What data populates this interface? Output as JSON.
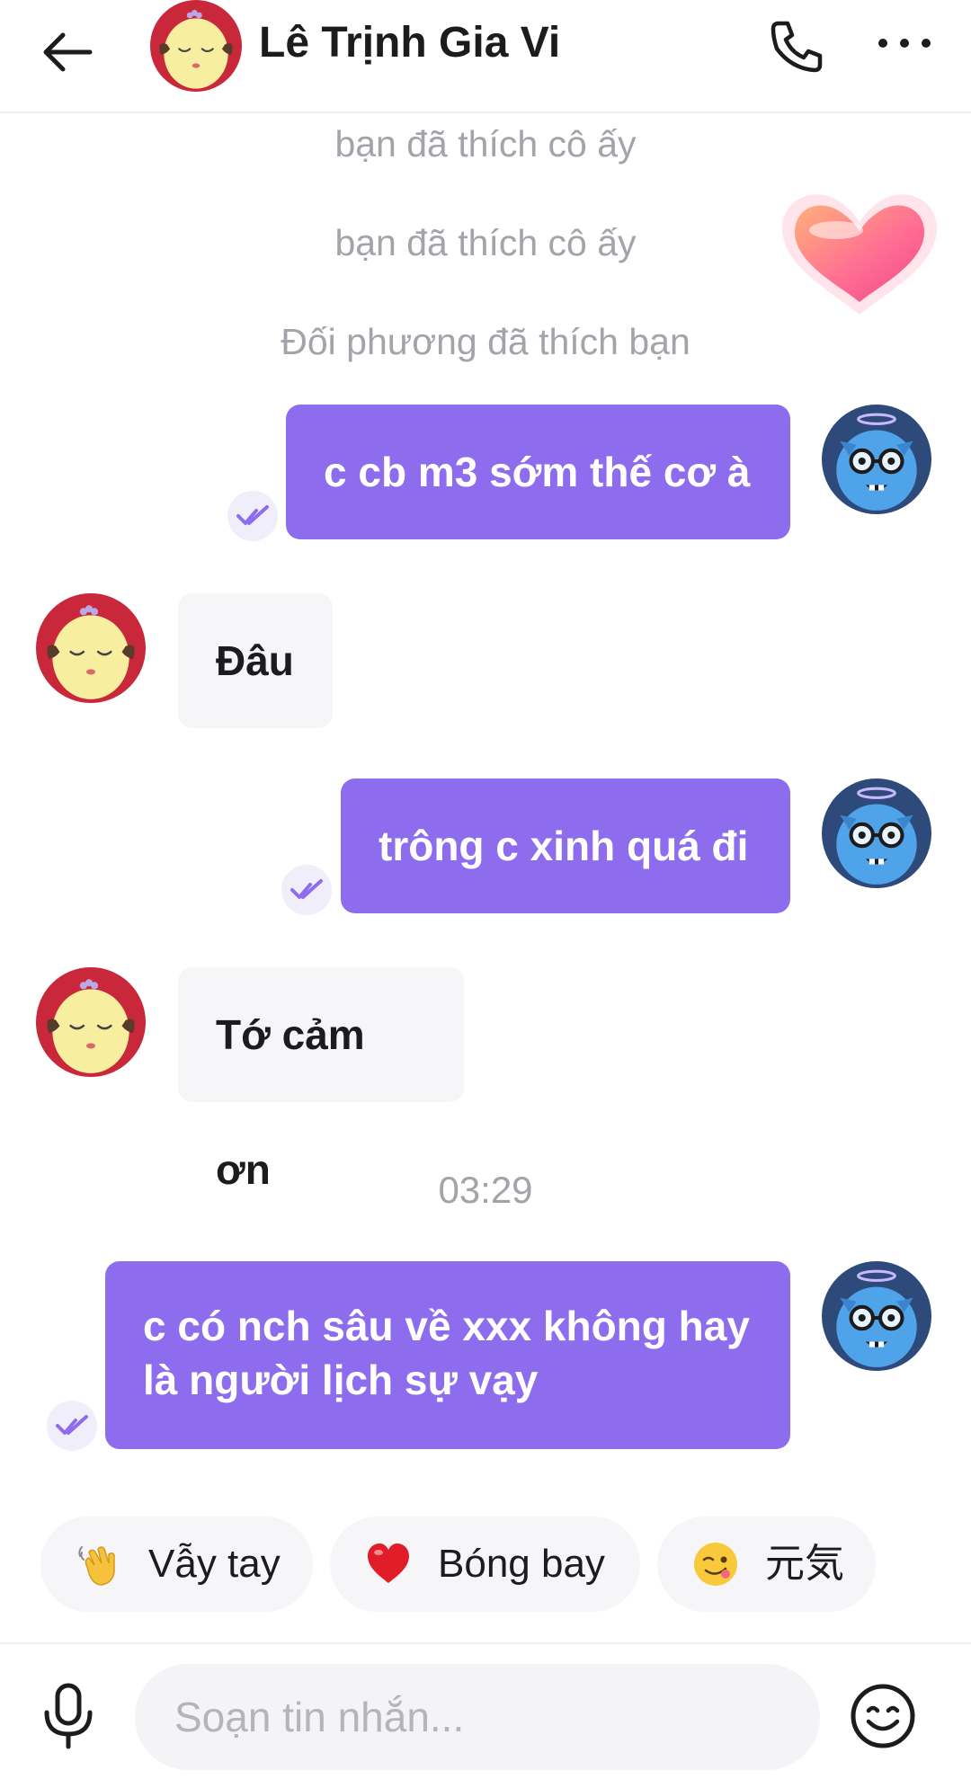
{
  "header": {
    "contact_name": "Lê Trịnh Gia Vi"
  },
  "system_messages": [
    "bạn đã thích cô ấy",
    "bạn đã thích cô ấy",
    "Đối phương đã thích bạn"
  ],
  "messages": [
    {
      "from": "me",
      "text": "c cb m3 sớm thế cơ à"
    },
    {
      "from": "them",
      "text": "Đâu"
    },
    {
      "from": "me",
      "text": "trông c xinh quá đi"
    },
    {
      "from": "them",
      "text": "Tớ cảm ơn"
    },
    {
      "from": "me",
      "text_line1": "c có nch sâu về xxx không hay",
      "text_line2": "là người lịch sự vạy"
    }
  ],
  "timestamp": "03:29",
  "quick_replies": [
    {
      "icon": "waving-hand-icon",
      "label": "Vẫy tay"
    },
    {
      "icon": "red-heart-icon",
      "label": "Bóng bay"
    },
    {
      "icon": "winking-face-icon",
      "label": "元気"
    }
  ],
  "composer": {
    "placeholder": "Soạn tin nhắn..."
  },
  "colors": {
    "outgoing_bubble": "#8e6cee",
    "incoming_bubble": "#f6f6f8",
    "system_text": "#a3a3aa"
  }
}
